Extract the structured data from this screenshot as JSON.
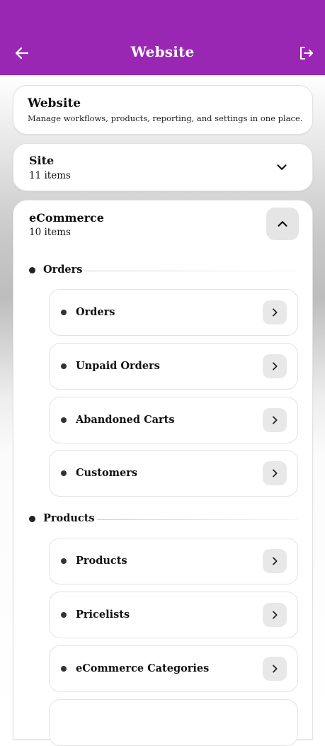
{
  "header": {
    "title": "Website",
    "back_icon": "arrow-left-icon",
    "logout_icon": "logout-icon",
    "bg_color": "#9a27b4"
  },
  "intro": {
    "title": "Website",
    "subtitle": "Manage workflows, products, reporting, and settings in one place."
  },
  "sections": [
    {
      "title": "Site",
      "count": "11 items",
      "expanded": false
    },
    {
      "title": "eCommerce",
      "count": "10 items",
      "expanded": true,
      "groups": [
        {
          "label": "Orders",
          "items": [
            "Orders",
            "Unpaid Orders",
            "Abandoned Carts",
            "Customers"
          ]
        },
        {
          "label": "Products",
          "items": [
            "Products",
            "Pricelists",
            "eCommerce Categories"
          ]
        }
      ]
    }
  ]
}
